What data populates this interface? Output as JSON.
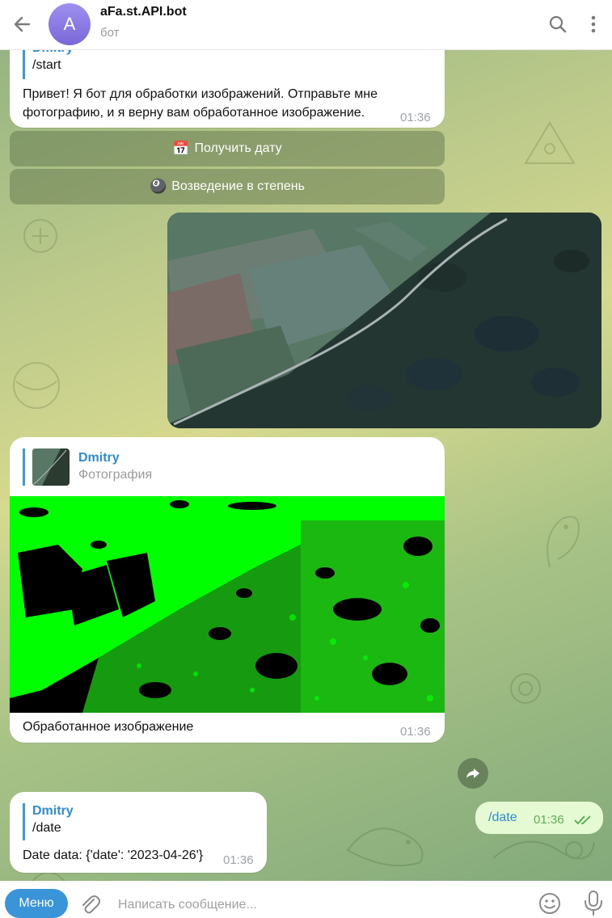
{
  "header": {
    "avatar_letter": "A",
    "title": "aFa.st.API.bot",
    "subtitle": "бот"
  },
  "messages": {
    "first": {
      "reply_name": "Dmitry",
      "reply_text": "/start",
      "line1": "Привет! Я бот для обработки изображений. Отправьте мне",
      "line2": "фотографию, и я верну вам обработанное изображение.",
      "time": "01:36"
    },
    "buttons": [
      {
        "emoji": "📅",
        "label": "Получить дату"
      },
      {
        "emoji": "🎱",
        "label": "Возведение в степень"
      }
    ],
    "processed": {
      "reply_name": "Dmitry",
      "reply_sub": "Фотография",
      "caption": "Обработанное изображение",
      "time": "01:36"
    },
    "outgoing": {
      "text": "/date",
      "time": "01:36"
    },
    "date_reply": {
      "reply_name": "Dmitry",
      "reply_text": "/date",
      "text": "Date data: {'date': '2023-04-26'}",
      "time": "01:36"
    }
  },
  "input": {
    "menu_label": "Меню",
    "placeholder": "Написать сообщение..."
  },
  "colors": {
    "accent": "#3a95d8",
    "outgoing_bubble": "#e5f9d2",
    "check": "#4fae4e",
    "segmentation_green": "#00ff00"
  }
}
